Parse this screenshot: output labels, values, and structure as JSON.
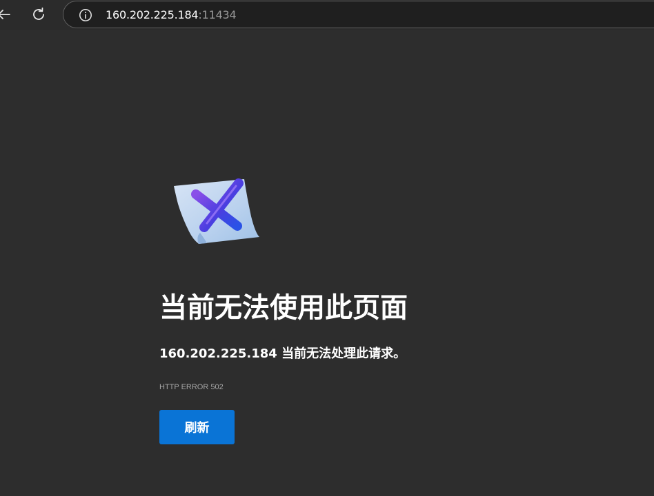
{
  "toolbar": {
    "back_icon": "back-arrow-icon",
    "reload_icon": "reload-icon",
    "site_info_icon": "info-icon"
  },
  "omnibox": {
    "host": "160.202.225.184",
    "port": ":11434"
  },
  "error_page": {
    "image": "error-document-x-icon",
    "headline": "当前无法使用此页面",
    "message": "160.202.225.184 当前无法处理此请求。",
    "error_code": "HTTP ERROR 502",
    "reload_label": "刷新"
  },
  "colors": {
    "background": "#2d2d2d",
    "toolbar": "#2b2b2b",
    "button": "#0a74d6",
    "text": "#ffffff",
    "muted_text": "#a6a6a6"
  }
}
